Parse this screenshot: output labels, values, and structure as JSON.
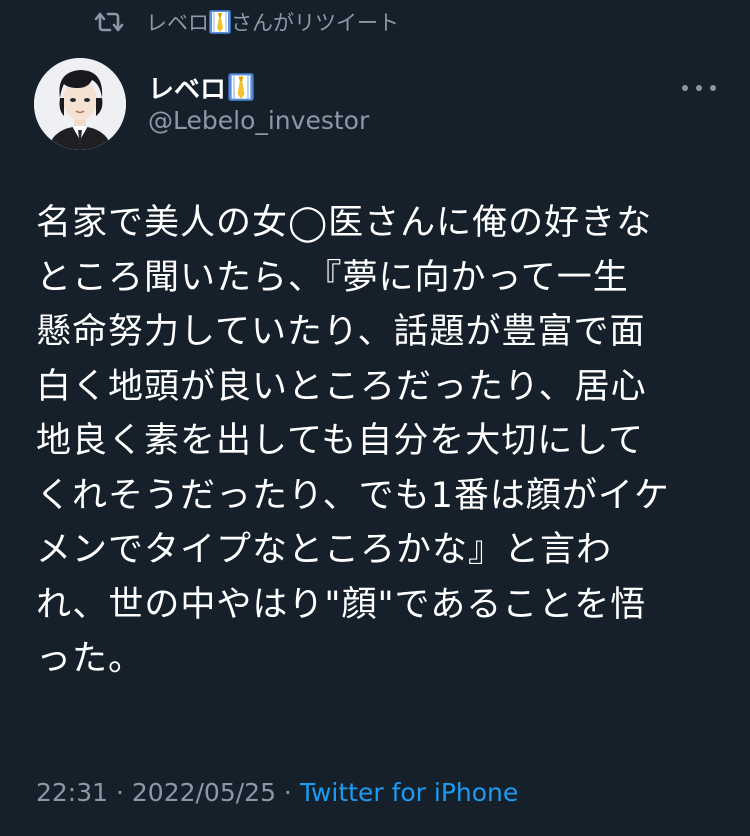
{
  "colors": {
    "background": "#15202b",
    "primary_text": "#ffffff",
    "secondary_text": "#8b98a5",
    "link": "#1d9bf0"
  },
  "retweet": {
    "icon": "retweet-icon",
    "name": "レベロ",
    "suffix": "さんがリツイート"
  },
  "author": {
    "avatar_icon": "avatar",
    "display_name": "レベロ",
    "name_emoji": "necktie-icon",
    "handle": "@Lebelo_investor"
  },
  "more_icon": "more-icon",
  "tweet": {
    "text": "名家で美人の女◯医さんに俺の好きな\nところ聞いたら、『夢に向かって一生\n懸命努力していたり、話題が豊富で面\n白く地頭が良いところだったり、居心\n地良く素を出しても自分を大切にして\nくれそうだったり、でも1番は顔がイケ\nメンでタイプなところかな』と言わ\nれ、世の中やはり\"顔\"であることを悟\nった。",
    "time": "22:31",
    "separator_1": " · ",
    "date": "2022/05/25",
    "separator_2": " · ",
    "source": "Twitter for iPhone"
  }
}
